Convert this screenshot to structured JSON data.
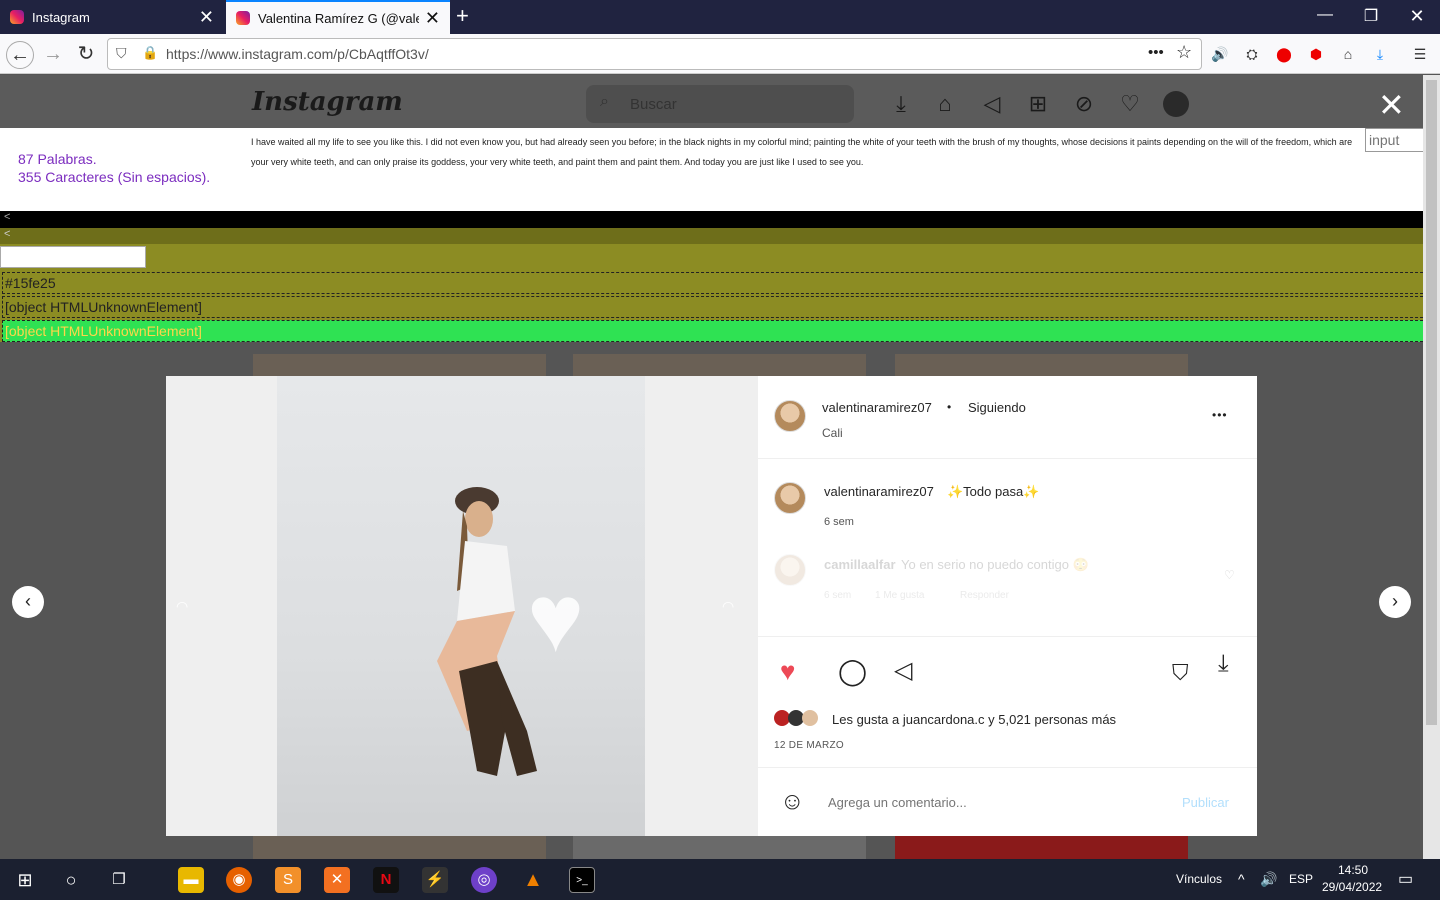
{
  "browser": {
    "tabs": [
      {
        "title": "Instagram"
      },
      {
        "title": "Valentina Ramírez G (@valentin"
      }
    ],
    "url": "https://www.instagram.com/p/CbAqtffOt3v/"
  },
  "instagram": {
    "logo": "Instagram",
    "search_placeholder": "Buscar"
  },
  "counter": {
    "words": "87 Palabras.",
    "chars": "355 Caracteres (Sin espacios).",
    "text": "I have waited all my life to see you like this. I did not even know you, but had already seen you before; in the black nights in my colorful mind; painting the white of your teeth with the brush of my thoughts, whose decisions it paints depending on the will of the freedom, which are your very white teeth, and can only praise its goddess, your very white teeth, and paint them and paint them. And today you are just like I used to see you.",
    "input_placeholder": "input"
  },
  "debug": {
    "hex": "#15fe25",
    "obj1": "[object HTMLUnknownElement]",
    "obj2": "[object HTMLUnknownElement]"
  },
  "post": {
    "username": "valentinaramirez07",
    "dot": "•",
    "following": "Siguiendo",
    "location": "Cali",
    "more": "•••",
    "caption_user": "valentinaramirez07",
    "caption": "✨Todo pasa✨",
    "caption_time": "6 sem",
    "comment_user": "camillaalfar",
    "comment_text": "Yo en serio no puedo contigo 😳",
    "comment_time": "6 sem",
    "comment_likes": "1 Me gusta",
    "comment_reply": "Responder",
    "likes_prefix": "Les gusta a",
    "likes_user": "juancardona.c",
    "likes_mid": "y",
    "likes_count": "5,021 personas más",
    "date": "12 DE MARZO",
    "add_comment_placeholder": "Agrega un comentario...",
    "publish": "Publicar"
  },
  "taskbar": {
    "links": "Vínculos",
    "lang": "ESP",
    "time": "14:50",
    "date": "29/04/2022"
  },
  "colors": {
    "accent": "#0a84ff",
    "like": "#ed4956",
    "publish": "#b2dffc",
    "counter": "#7b2cbf",
    "olive": "#8c8c23",
    "green": "#2fe253"
  }
}
